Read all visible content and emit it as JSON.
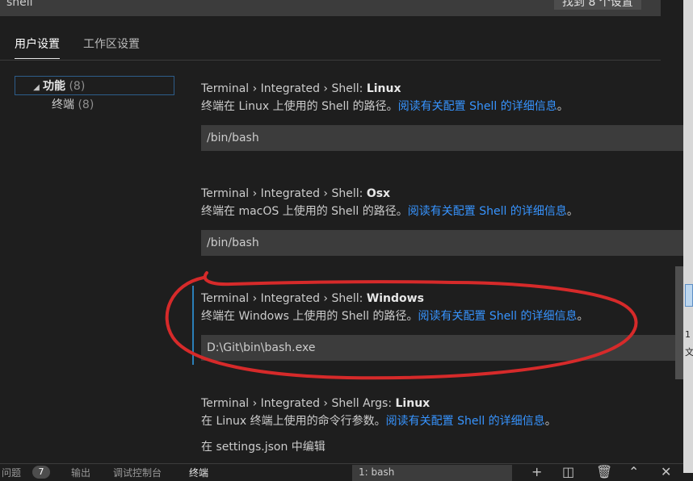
{
  "search": {
    "value": "shell",
    "result_count": "找到 8 个设置"
  },
  "tabs": [
    {
      "label": "用户设置",
      "active": true
    },
    {
      "label": "工作区设置",
      "active": false
    }
  ],
  "toc": [
    {
      "label": "功能",
      "count": "(8)",
      "expanded": true
    },
    {
      "label": "终端",
      "count": "(8)"
    }
  ],
  "settings": [
    {
      "category": "Terminal › Integrated › Shell: ",
      "name": "Linux",
      "description": "终端在 Linux 上使用的 Shell 的路径。",
      "link": "阅读有关配置 Shell 的详细信息",
      "link_suffix": "。",
      "value": "/bin/bash"
    },
    {
      "category": "Terminal › Integrated › Shell: ",
      "name": "Osx",
      "description": "终端在 macOS 上使用的 Shell 的路径。",
      "link": "阅读有关配置 Shell 的详细信息",
      "link_suffix": "。",
      "value": "/bin/bash"
    },
    {
      "category": "Terminal › Integrated › Shell: ",
      "name": "Windows",
      "description": "终端在 Windows 上使用的 Shell 的路径。",
      "link": "阅读有关配置 Shell 的详细信息",
      "link_suffix": "。",
      "value": "D:\\Git\\bin\\bash.exe",
      "modified": true
    },
    {
      "category": "Terminal › Integrated › Shell Args: ",
      "name": "Linux",
      "description": "在 Linux 终端上使用的命令行参数。",
      "link": "阅读有关配置 Shell 的详细信息",
      "link_suffix": "。",
      "edit_in_json": "在 settings.json 中编辑"
    }
  ],
  "panel": {
    "tabs": [
      "问题",
      "输出",
      "调试控制台",
      "终端"
    ],
    "problems_count": "7",
    "active_tab": "终端",
    "terminal_select": "1: bash"
  },
  "right_strip": {
    "text1": "1",
    "text2": "文"
  },
  "colors": {
    "background": "#1e1e1e",
    "input_background": "#3c3c3c",
    "link": "#3794ff",
    "modified_indicator": "#2a7fb8",
    "annotation": "#d62a2a"
  },
  "icons": [
    "expanded-triangle-icon",
    "plus-icon",
    "split-icon",
    "trash-icon",
    "chevron-up-icon",
    "close-icon"
  ]
}
